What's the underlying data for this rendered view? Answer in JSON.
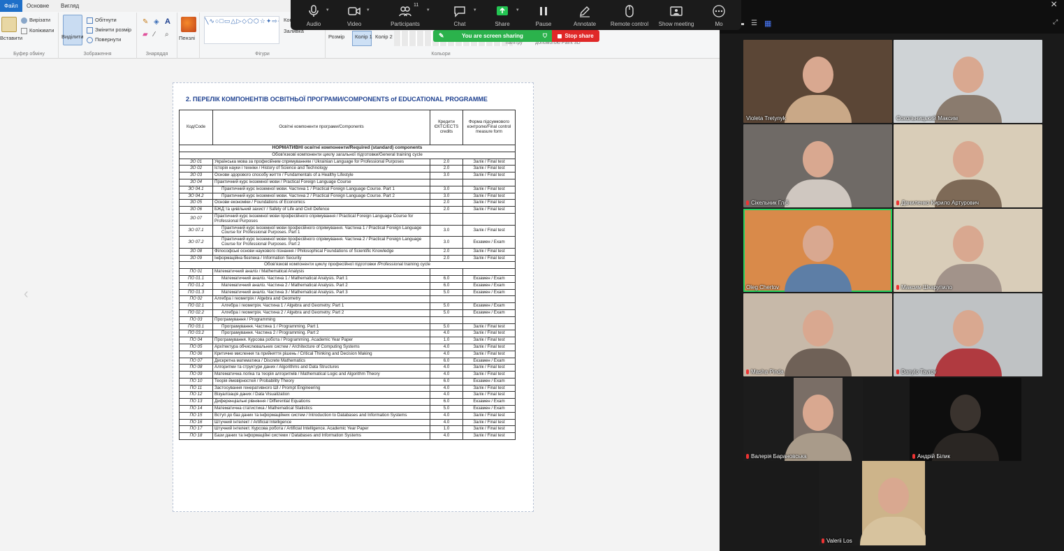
{
  "paint": {
    "tabs": {
      "file": "Файл",
      "home": "Основне",
      "view": "Вигляд"
    },
    "clipboard": {
      "paste": "Вставити",
      "cut": "Вирізати",
      "copy": "Копіювати",
      "label": "Буфер обміну"
    },
    "image": {
      "select": "Виділити",
      "crop": "Обітнути",
      "resize": "Змінити розмір",
      "rotate": "Повернути",
      "label": "Зображення"
    },
    "tools": {
      "label": "Знаряддя",
      "brushes": "Пензлі"
    },
    "shapes": {
      "label": "Фігури",
      "outline": "Контур",
      "fill": "Заливка"
    },
    "size": "Розмір",
    "color1": "Колір 1",
    "color2": "Колір 2",
    "colors_label": "Кольори",
    "edit_colors": "палітру",
    "paint3d": "допомогою Paint 3D"
  },
  "zoom": {
    "toolbar": {
      "audio": "Audio",
      "video": "Video",
      "participants": "Participants",
      "participants_count": "11",
      "chat": "Chat",
      "share": "Share",
      "pause": "Pause",
      "annotate": "Annotate",
      "remote_control": "Remote control",
      "show_meeting": "Show meeting",
      "more": "Mo"
    },
    "banner": {
      "sharing": "You are screen sharing",
      "stop": "Stop share"
    },
    "participants": [
      {
        "name": "Violeta Tretynyk"
      },
      {
        "name": "Сокольницький Максим"
      },
      {
        "name": "Сікельник Гліб"
      },
      {
        "name": "Даниленко Кирило Артурович"
      },
      {
        "name": "Oleg Chertov"
      },
      {
        "name": "Максим Шкарупило"
      },
      {
        "name": "Masha Pinda"
      },
      {
        "name": "Danylo Tavrov"
      },
      {
        "name": "Валерія Барановська"
      },
      {
        "name": "Андрій Білик"
      },
      {
        "name": "Valerii Los"
      }
    ]
  },
  "document": {
    "title": "2. ПЕРЕЛІК КОМПОНЕНТІВ ОСВІТНЬОЇ ПРОГРАМИ/COMPONENTS of EDUCATIONAL PROGRAMME",
    "headers": {
      "code": "Код/Code",
      "name": "Освітні компоненти програми/Components",
      "credits": "Кредити ЄКТС/ECTS credits",
      "form": "Форма підсумкового контролю/Final control measure form"
    },
    "rows": [
      {
        "kind": "sec",
        "text": "НОРМАТИВНІ освітні компоненти/Required (standard) components"
      },
      {
        "kind": "sub",
        "text": "Обов'язкові компоненти циклу загальної підготовки/General training cycle"
      },
      {
        "code": "ЗО 01",
        "name": "Українська мова за професійним спрямуванням / Ukrainian Language for Professional Purposes",
        "cr": "2.0",
        "fm": "Залік / Final test"
      },
      {
        "code": "ЗО 02",
        "name": "Історія науки і техніки / History of Science and Technology",
        "cr": "2.0",
        "fm": "Залік / Final test"
      },
      {
        "code": "ЗО 03",
        "name": "Основи здорового способу життя / Fundamentals of a Healthy Lifestyle",
        "cr": "3.0",
        "fm": "Залік / Final test"
      },
      {
        "code": "ЗО 04",
        "name": "Практичний курс іноземної мови / Practical Foreign Language Course",
        "cr": "",
        "fm": ""
      },
      {
        "code": "ЗО 04.1",
        "ind": true,
        "name": "Практичний курс іноземної мови. Частина 1 / Practical Foreign Language Course. Part 1",
        "cr": "3.0",
        "fm": "Залік / Final test"
      },
      {
        "code": "ЗО 04.2",
        "ind": true,
        "name": "Практичний курс іноземної мови. Частина 2 / Practical Foreign Language Course. Part 2",
        "cr": "3.0",
        "fm": "Залік / Final test"
      },
      {
        "code": "ЗО 05",
        "name": "Основи економіки / Foundations of Economics",
        "cr": "2.0",
        "fm": "Залік / Final test"
      },
      {
        "code": "ЗО 06",
        "name": "БЖД та цивільний захист / Safety of Life and Civil Defence",
        "cr": "2.0",
        "fm": "Залік / Final test"
      },
      {
        "code": "ЗО 07",
        "name": "Практичний курс іноземної мови професійного спрямування / Practical Foreign Language Course for Professional Purposes",
        "cr": "",
        "fm": ""
      },
      {
        "code": "ЗО 07.1",
        "ind": true,
        "name": "Практичний курс іноземної мови професійного спрямування. Частина 1 / Practical Foreign Language Course for Professional Purposes. Part 1",
        "cr": "3.0",
        "fm": "Залік / Final test"
      },
      {
        "code": "ЗО 07.2",
        "ind": true,
        "name": "Практичний курс іноземної мови професійного спрямування. Частина 2 / Practical Foreign Language Course for Professional Purposes. Part 2",
        "cr": "3.0",
        "fm": "Екзамен / Exam"
      },
      {
        "code": "ЗО 08",
        "name": "Філософські основи наукового пізнання / Philosophical Foundations of Scientific Knowledge",
        "cr": "2.0",
        "fm": "Залік / Final test"
      },
      {
        "code": "ЗО 09",
        "name": "Інформаційна безпека / Information Security",
        "cr": "2.0",
        "fm": "Залік / Final test"
      },
      {
        "kind": "sub",
        "text": "Обов'язкові компоненти циклу професійної підготовки /Professional training cycle"
      },
      {
        "code": "ПО 01",
        "name": "Математичний аналіз / Mathematical Analysis",
        "cr": "",
        "fm": ""
      },
      {
        "code": "ПО 01.1",
        "ind": true,
        "name": "Математичний аналіз. Частина 1 / Mathematical Analysis. Part 1",
        "cr": "6.0",
        "fm": "Екзамен / Exam"
      },
      {
        "code": "ПО 01.2",
        "ind": true,
        "name": "Математичний аналіз. Частина 2 / Mathematical Analysis. Part 2",
        "cr": "6.0",
        "fm": "Екзамен / Exam"
      },
      {
        "code": "ПО 01.3",
        "ind": true,
        "name": "Математичний аналіз. Частина 3 / Mathematical Analysis. Part 3",
        "cr": "5.0",
        "fm": "Екзамен / Exam"
      },
      {
        "code": "ПО 02",
        "name": "Алгебра і геометрія / Algebra and Geometry",
        "cr": "",
        "fm": ""
      },
      {
        "code": "ПО 02.1",
        "ind": true,
        "name": "Алгебра і геометрія. Частина 1 / Algebra and Geometry. Part 1",
        "cr": "5.0",
        "fm": "Екзамен / Exam"
      },
      {
        "code": "ПО 02.2",
        "ind": true,
        "name": "Алгебра і геометрія. Частина 2 / Algebra and Geometry. Part 2",
        "cr": "5.0",
        "fm": "Екзамен / Exam"
      },
      {
        "code": "ПО 03",
        "name": "Програмування / Programming",
        "cr": "",
        "fm": ""
      },
      {
        "code": "ПО 03.1",
        "ind": true,
        "name": "Програмування. Частина 1 / Programming. Part 1",
        "cr": "5.0",
        "fm": "Залік / Final test"
      },
      {
        "code": "ПО 03.2",
        "ind": true,
        "name": "Програмування. Частина 2 / Programming. Part 2",
        "cr": "4.0",
        "fm": "Залік / Final test"
      },
      {
        "code": "ПО 04",
        "name": "Програмування. Курсова робота / Programming. Academic Year Paper",
        "cr": "1.0",
        "fm": "Залік / Final test"
      },
      {
        "code": "ПО 05",
        "name": "Архітектура обчислювальних систем / Architecture of Computing Systems",
        "cr": "4.0",
        "fm": "Залік / Final test"
      },
      {
        "code": "ПО 06",
        "name": "Критичне мислення та прийняття рішень / Critical Thinking and Decision Making",
        "cr": "4.0",
        "fm": "Залік / Final test"
      },
      {
        "code": "ПО 07",
        "name": "Дискретна математика / Discrete Mathematics",
        "cr": "6.0",
        "fm": "Екзамен / Exam"
      },
      {
        "code": "ПО 08",
        "name": "Алгоритми та структури даних / Algorithms and Data Structures",
        "cr": "4.0",
        "fm": "Залік / Final test"
      },
      {
        "code": "ПО 09",
        "name": "Математична логіка та теорія алгоритмів / Mathematical Logic and Algorithm Theory",
        "cr": "4.0",
        "fm": "Залік / Final test"
      },
      {
        "code": "ПО 10",
        "name": "Теорія ймовірностей / Probability Theory",
        "cr": "6.0",
        "fm": "Екзамен / Exam"
      },
      {
        "code": "ПО 11",
        "name": "Застосування генеративного ШІ / Prompt Engineering",
        "cr": "4.0",
        "fm": "Залік / Final test"
      },
      {
        "code": "ПО 12",
        "name": "Візуалізація даних / Data Visualization",
        "cr": "4.0",
        "fm": "Залік / Final test"
      },
      {
        "code": "ПО 13",
        "name": "Диференціальні рівняння / Differential Equations",
        "cr": "6.0",
        "fm": "Екзамен / Exam"
      },
      {
        "code": "ПО 14",
        "name": "Математична статистика / Mathematical Statistics",
        "cr": "5.0",
        "fm": "Екзамен / Exam"
      },
      {
        "code": "ПО 15",
        "name": "Вступ до баз даних та інформаційних систем / Introduction to Databases and Information Systems",
        "cr": "4.0",
        "fm": "Залік / Final test"
      },
      {
        "code": "ПО 16",
        "name": "Штучний інтелект / Artificial Intelligence",
        "cr": "4.0",
        "fm": "Залік / Final test"
      },
      {
        "code": "ПО 17",
        "name": "Штучний інтелект. Курсова робота / Artificial Intelligence. Academic Year Paper",
        "cr": "1.0",
        "fm": "Залік / Final test"
      },
      {
        "code": "ПО 18",
        "name": "Бази даних та інформаційні системи / Databases and Information Systems",
        "cr": "4.0",
        "fm": "Залік / Final test"
      }
    ]
  },
  "colors": {
    "zoom_green": "#23d160",
    "stop_red": "#e02828",
    "share_green": "#2bb24c",
    "toolbar_bg": "#1b1b1b"
  }
}
